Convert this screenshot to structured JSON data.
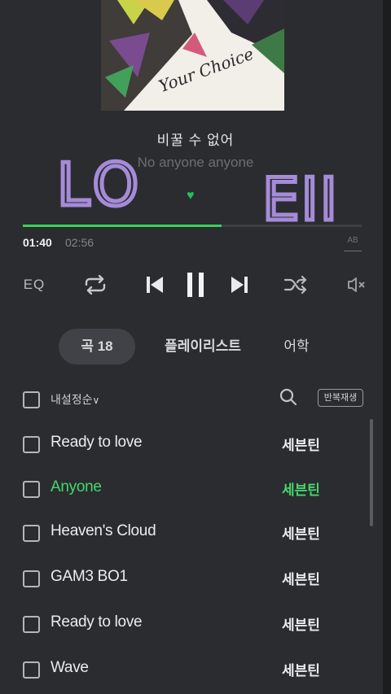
{
  "player": {
    "album_text": "Your Choice",
    "lyric_current": "비꿀 수 없어",
    "lyric_next": "No anyone anyone",
    "handwriting_left": "LO",
    "handwriting_right": "EII",
    "time_current": "01:40",
    "time_total": "02:56",
    "progress_fraction": 0.587,
    "ab_label": "AB",
    "eq_label": "EQ"
  },
  "tabs": [
    {
      "label": "곡 18"
    },
    {
      "label": "플레이리스트"
    },
    {
      "label": "어학"
    }
  ],
  "list_header": {
    "sort_label": "내설정순",
    "sort_caret": "∨",
    "repeat_play_label": "반복재생"
  },
  "tracks": [
    {
      "title": "Ready to love",
      "artist": "세븐틴"
    },
    {
      "title": "Anyone",
      "artist": "세븐틴"
    },
    {
      "title": "Heaven's Cloud",
      "artist": "세븐틴"
    },
    {
      "title": "GAM3 BO1",
      "artist": "세븐틴"
    },
    {
      "title": "Ready to love",
      "artist": "세븐틴"
    },
    {
      "title": "Wave",
      "artist": "세븐틴"
    }
  ],
  "colors": {
    "accent": "#36d25c",
    "handwriting": "#a58bd8",
    "background": "#2b2c2f"
  },
  "icons": [
    "repeat-icon",
    "previous-icon",
    "pause-icon",
    "next-icon",
    "shuffle-icon",
    "mute-icon",
    "search-icon",
    "heart-icon"
  ]
}
